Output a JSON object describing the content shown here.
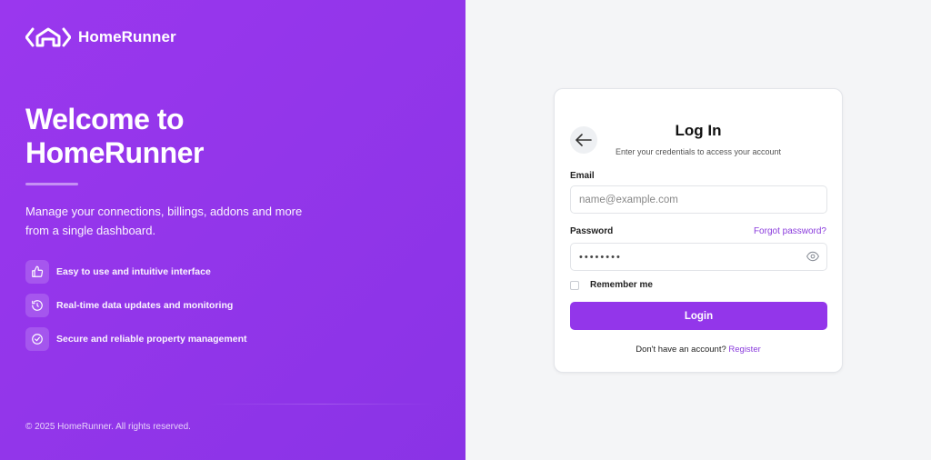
{
  "brand": {
    "name": "HomeRunner",
    "logo_icon": "house-code-logo-icon"
  },
  "hero": {
    "heading_line1": "Welcome to",
    "heading_line2": "HomeRunner",
    "description": "Manage your connections, billings, addons and more from a single dashboard."
  },
  "features": [
    {
      "icon": "thumbs-up-icon",
      "text": "Easy to use and intuitive interface"
    },
    {
      "icon": "clock-refresh-icon",
      "text": "Real-time data updates and monitoring"
    },
    {
      "icon": "check-circle-icon",
      "text": "Secure and reliable property management"
    }
  ],
  "footer": {
    "copyright": "© 2025 HomeRunner. All rights reserved."
  },
  "login": {
    "title": "Log In",
    "subtitle": "Enter your credentials to access your account",
    "email_label": "Email",
    "email_placeholder": "name@example.com",
    "email_value": "",
    "password_label": "Password",
    "forgot_label": "Forgot password?",
    "password_value": "••••••••",
    "remember_label": "Remember me",
    "remember_checked": false,
    "submit_label": "Login",
    "register_prompt": "Don't have an account?",
    "register_link": "Register"
  },
  "colors": {
    "accent": "#9336ea",
    "link": "#8a3bdc",
    "panel_bg": "#f4f5f7"
  }
}
